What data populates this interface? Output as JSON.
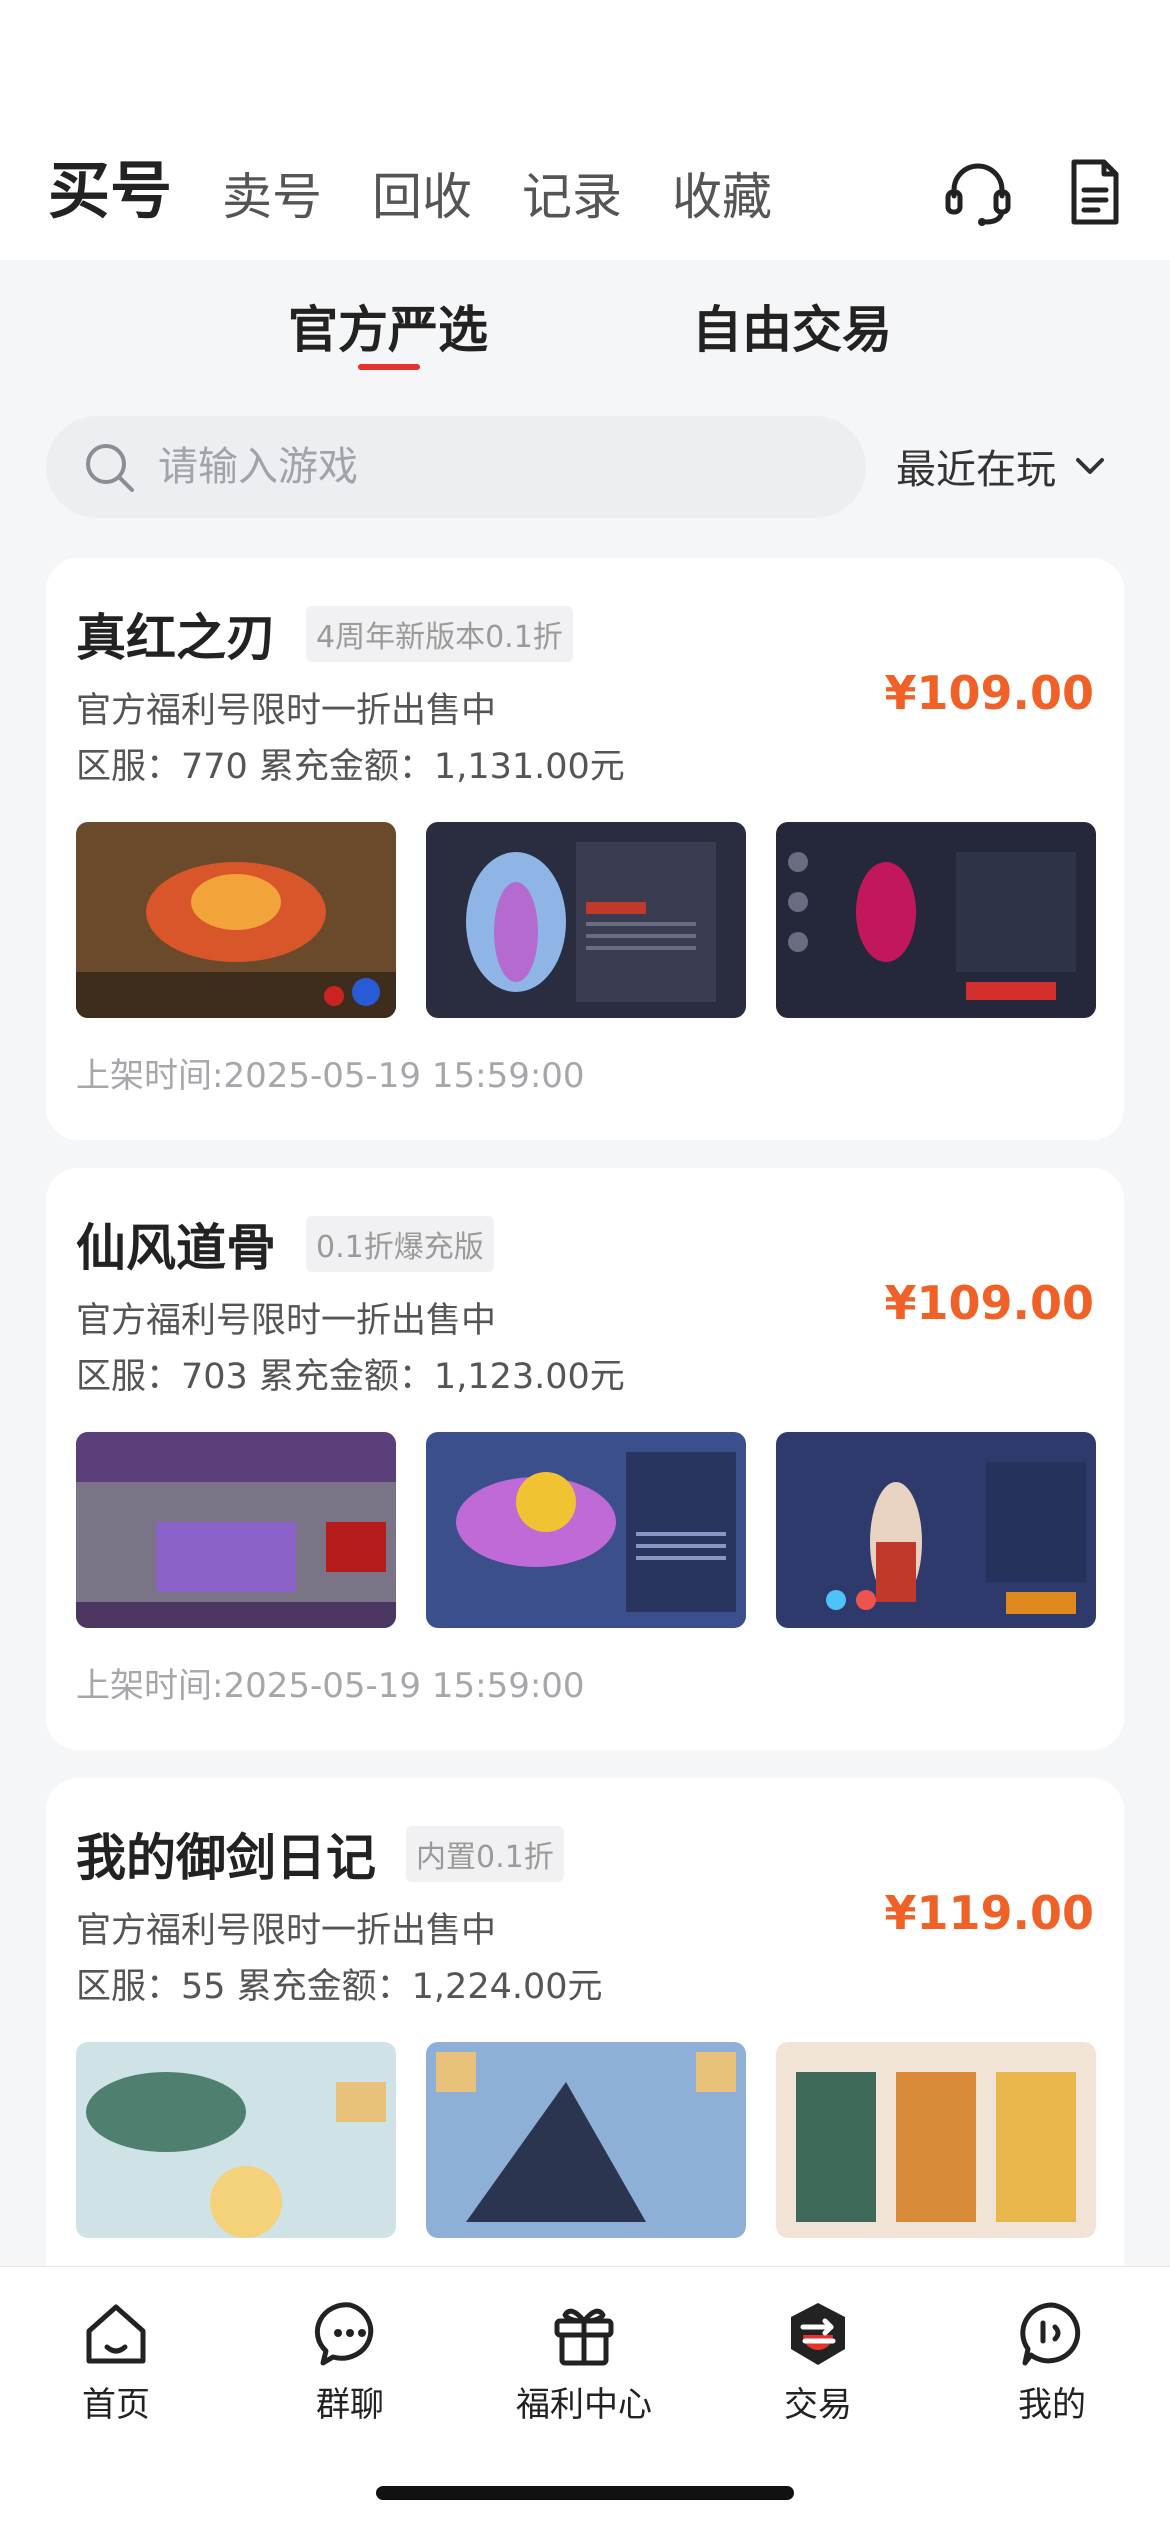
{
  "header": {
    "tabs": [
      {
        "label": "买号"
      },
      {
        "label": "卖号"
      },
      {
        "label": "回收"
      },
      {
        "label": "记录"
      },
      {
        "label": "收藏"
      }
    ],
    "icons": [
      "headset-icon",
      "document-icon"
    ]
  },
  "sub_tabs": [
    {
      "label": "官方严选"
    },
    {
      "label": "自由交易"
    }
  ],
  "search": {
    "placeholder": "请输入游戏",
    "value": ""
  },
  "filter": {
    "label": "最近在玩"
  },
  "cards": [
    {
      "title": "真红之刃",
      "tag": "4周年新版本0.1折",
      "desc": "官方福利号限时一折出售中",
      "meta": "区服：770 累充金额：1,131.00元",
      "price": "¥109.00",
      "time": "上架时间:2025-05-19 15:59:00"
    },
    {
      "title": "仙风道骨",
      "tag": "0.1折爆充版",
      "desc": "官方福利号限时一折出售中",
      "meta": "区服：703 累充金额：1,123.00元",
      "price": "¥109.00",
      "time": "上架时间:2025-05-19 15:59:00"
    },
    {
      "title": "我的御剑日记",
      "tag": "内置0.1折",
      "desc": "官方福利号限时一折出售中",
      "meta": "区服：55 累充金额：1,224.00元",
      "price": "¥119.00",
      "time": ""
    }
  ],
  "bottom_nav": [
    {
      "label": "首页",
      "icon": "home-icon"
    },
    {
      "label": "群聊",
      "icon": "chat-icon"
    },
    {
      "label": "福利中心",
      "icon": "gift-icon"
    },
    {
      "label": "交易",
      "icon": "trade-icon"
    },
    {
      "label": "我的",
      "icon": "profile-icon"
    }
  ],
  "colors": {
    "accent": "#e5322d",
    "price": "#ef6126",
    "background": "#f5f6f8"
  }
}
